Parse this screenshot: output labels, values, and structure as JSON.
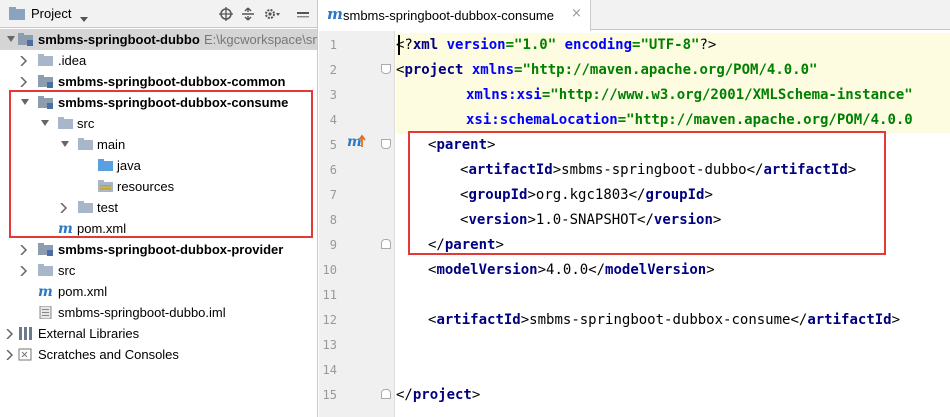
{
  "panel": {
    "title": "Project",
    "tree": [
      {
        "label": "smbms-springboot-dubbo",
        "path": "E:\\kgcworkspace\\sm"
      },
      {
        "label": ".idea"
      },
      {
        "label": "smbms-springboot-dubbox-common"
      },
      {
        "label": "smbms-springboot-dubbox-consume"
      },
      {
        "label": "src"
      },
      {
        "label": "main"
      },
      {
        "label": "java"
      },
      {
        "label": "resources"
      },
      {
        "label": "test"
      },
      {
        "label": "pom.xml"
      },
      {
        "label": "smbms-springboot-dubbox-provider"
      },
      {
        "label": "src"
      },
      {
        "label": "pom.xml"
      },
      {
        "label": "smbms-springboot-dubbo.iml"
      },
      {
        "label": "External Libraries"
      },
      {
        "label": "Scratches and Consoles"
      }
    ]
  },
  "editor": {
    "tab": {
      "icon": "m",
      "name": "smbms-springboot-dubbox-consume",
      "close": "×"
    },
    "line_numbers": [
      "1",
      "2",
      "3",
      "4",
      "5",
      "6",
      "7",
      "8",
      "9",
      "10",
      "11",
      "12",
      "13",
      "14",
      "15"
    ],
    "code": {
      "l1_open": "<?",
      "l1_tag": "xml",
      "l1_a1": " version",
      "l1_v1": "=\"1.0\"",
      "l1_a2": " encoding",
      "l1_v2": "=\"UTF-8\"",
      "l1_close": "?>",
      "l2_tag": "project",
      "l2_attr": " xmlns",
      "l2_val": "=\"http://maven.apache.org/POM/4.0.0\"",
      "l3_attr": "xmlns:xsi",
      "l3_val": "=\"http://www.w3.org/2001/XMLSchema-instance\"",
      "l4_attr": "xsi:schemaLocation",
      "l4_val": "=\"http://maven.apache.org/POM/4.0.0",
      "parent": "parent",
      "artifactId": "artifactId",
      "artifact_val": "smbms-springboot-dubbo",
      "groupId": "groupId",
      "group_val": "org.kgc1803",
      "version": "version",
      "version_val": "1.0-SNAPSHOT",
      "modelVersion": "modelVersion",
      "model_val": "4.0.0",
      "artifact2_val": "smbms-springboot-dubbox-consume",
      "project": "project"
    }
  },
  "colors": {
    "highlight": "#e53935",
    "tag": "#000080",
    "attr": "#0000ff",
    "value": "#008000"
  }
}
